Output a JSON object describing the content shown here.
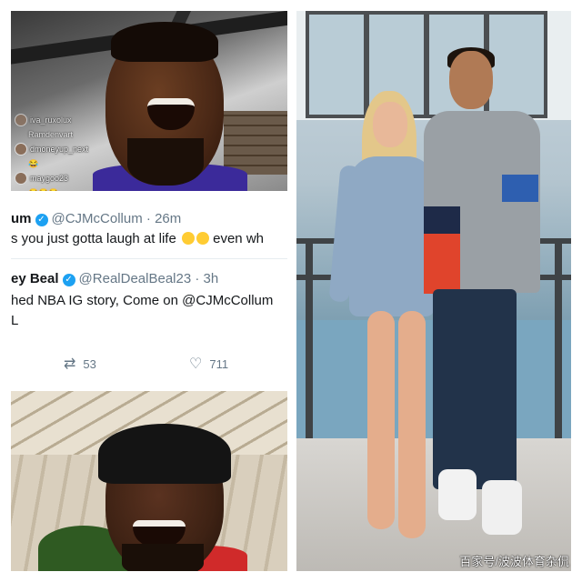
{
  "live_top": {
    "comments": [
      {
        "user": "iva_ruxolux",
        "text": ""
      },
      {
        "user": "Ramdenvart",
        "text": ""
      },
      {
        "user": "dmoneyup_next",
        "text": "😂"
      },
      {
        "user": "maygoo23",
        "text": "😂😂😂"
      }
    ]
  },
  "tweet1": {
    "name": "um",
    "handle": "@CJMcCollum",
    "time": "· 26m",
    "text": "s you just gotta laugh at life",
    "text_tail": "even wh"
  },
  "tweet2": {
    "name": "ey Beal",
    "handle": "@RealDealBeal23",
    "time": "· 3h",
    "line1": "hed NBA IG story, Come on @CJMcCollum",
    "line2": "L"
  },
  "actions": {
    "retweet_icon": "retweet-icon",
    "retweet_count": "53",
    "like_icon": "heart-icon",
    "like_count": "711"
  },
  "watermark": "百家号/波波体育杂侃",
  "colors": {
    "twitter_blue": "#1da1f2",
    "text_gray": "#657786",
    "text_dark": "#14171a"
  }
}
